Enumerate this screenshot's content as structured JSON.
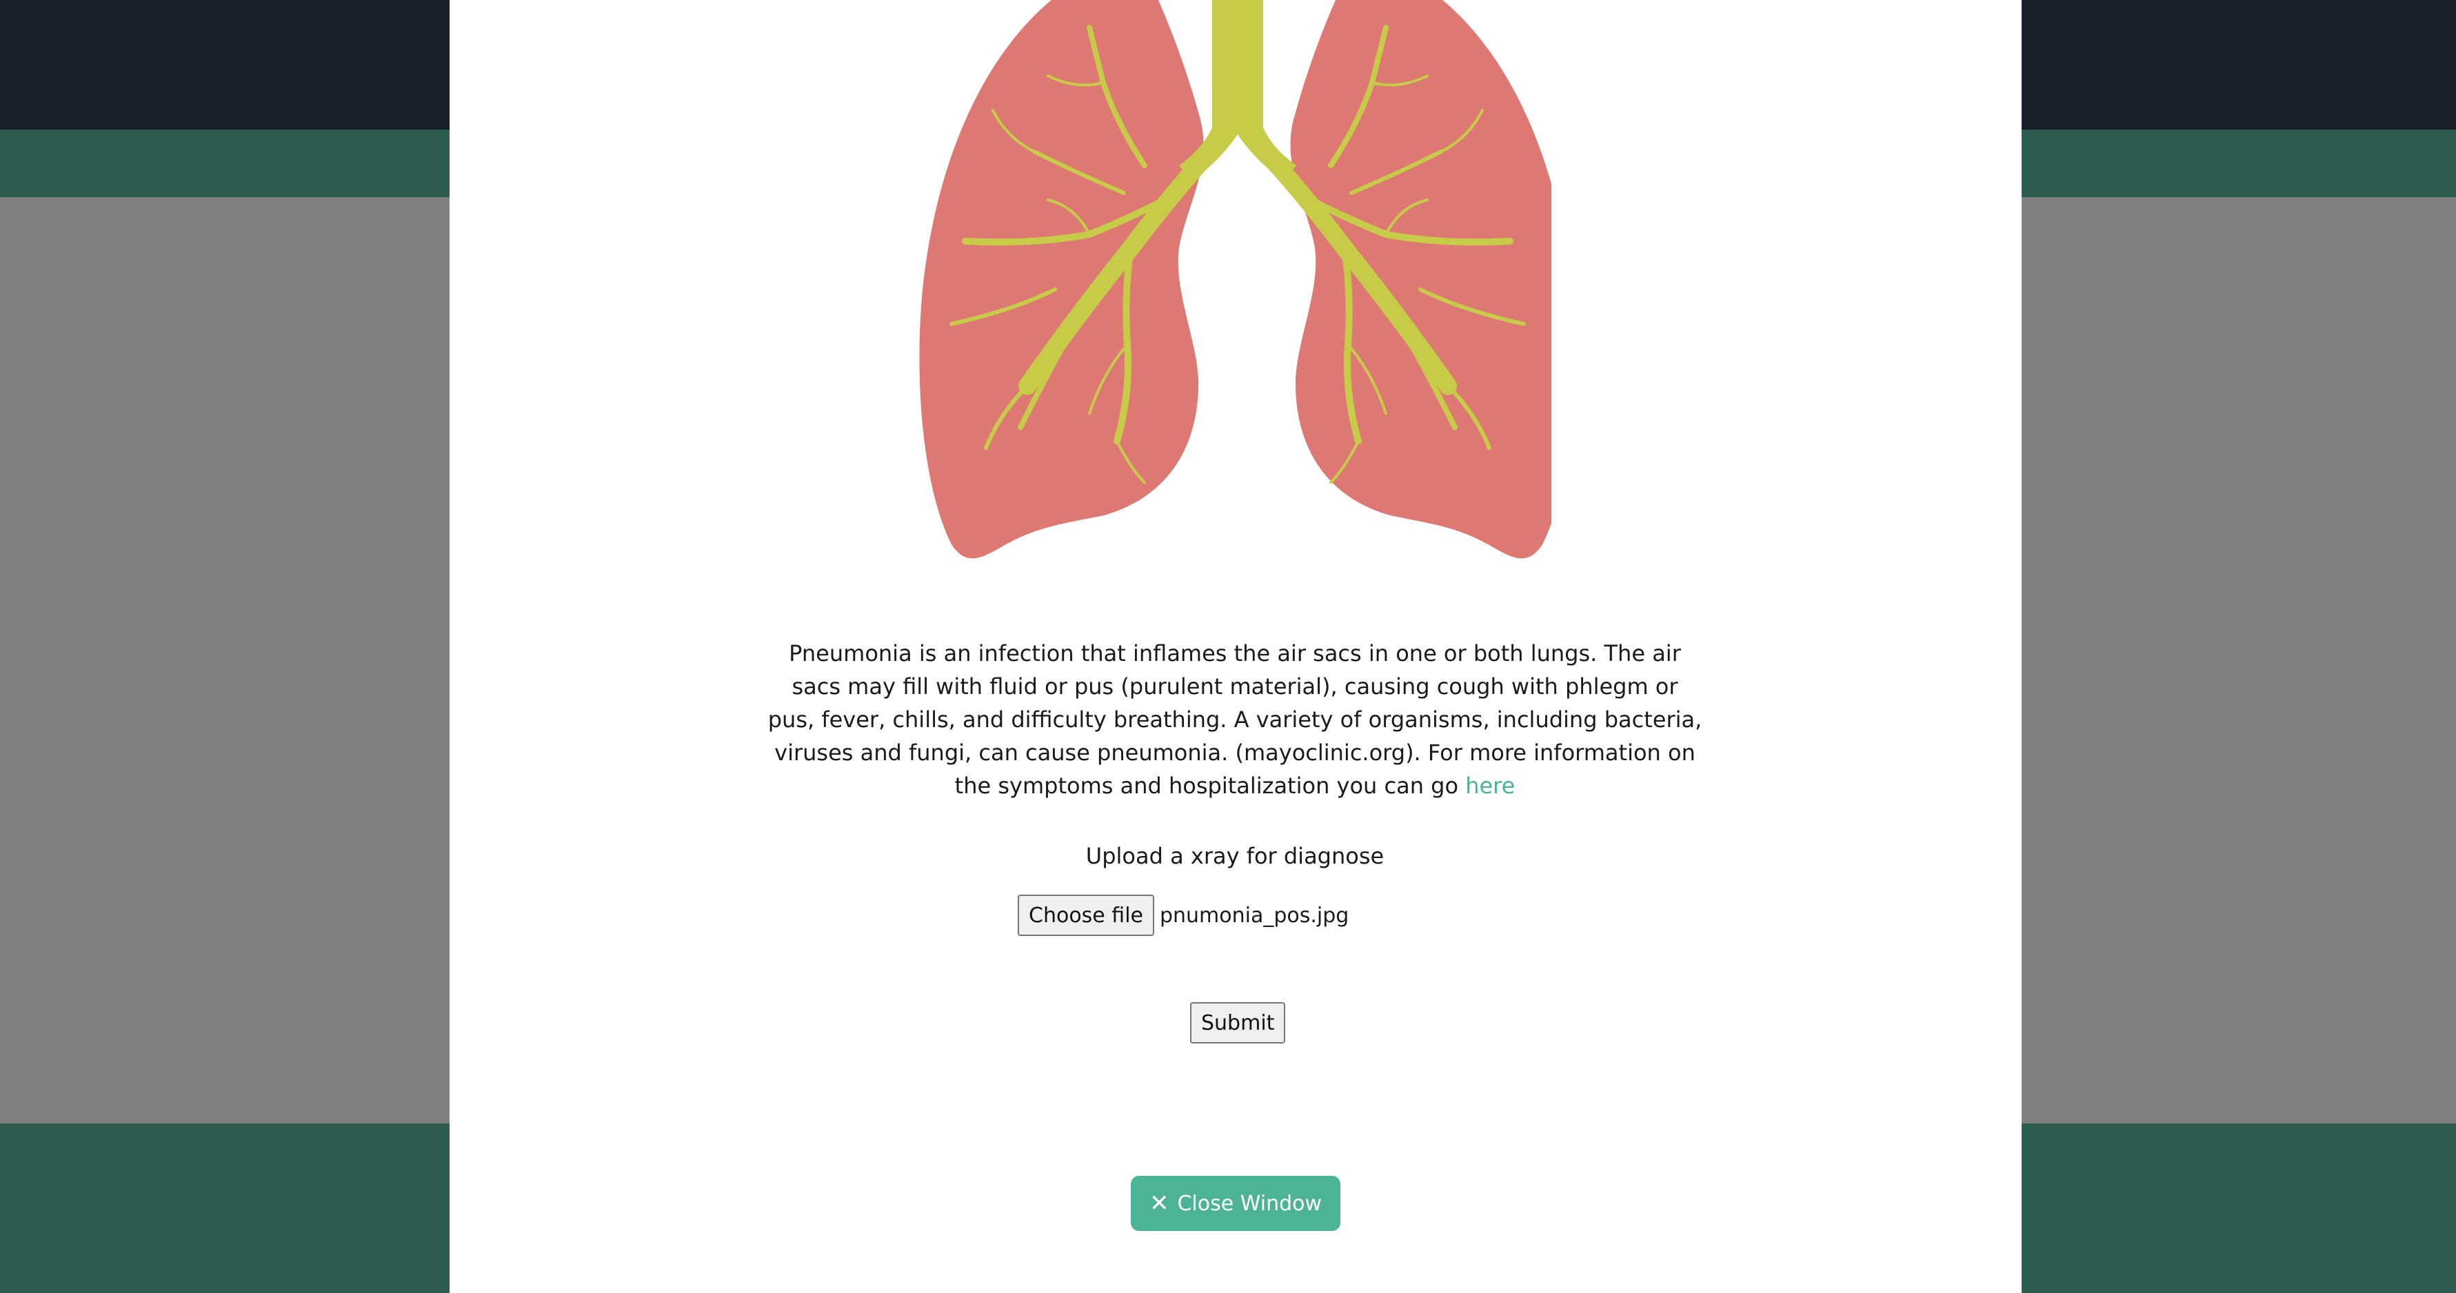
{
  "modal": {
    "description_text": "Pneumonia is an infection that inflames the air sacs in one or both lungs. The air sacs may fill with fluid or pus (purulent material), causing cough with phlegm or pus, fever, chills, and difficulty breathing. A variety of organisms, including bacteria, viruses and fungi, can cause pneumonia. (mayoclinic.org). For more information on the symptoms and hospitalization you can go ",
    "link_label": "here",
    "upload_label": "Upload a xray for diagnose",
    "choose_file_label": "Choose file",
    "selected_file": "pnumonia_pos.jpg",
    "submit_label": "Submit",
    "close_icon": "✕",
    "close_label": "Close Window"
  },
  "icons": {
    "lungs": "lungs-illustration",
    "close": "close-icon"
  },
  "colors": {
    "navbar": "#19202a",
    "green_band": "#2c5c4f",
    "overlay": "#808080",
    "modal_bg": "#ffffff",
    "accent": "#4db396",
    "lung": "#de7873",
    "airway": "#c6cc47"
  }
}
